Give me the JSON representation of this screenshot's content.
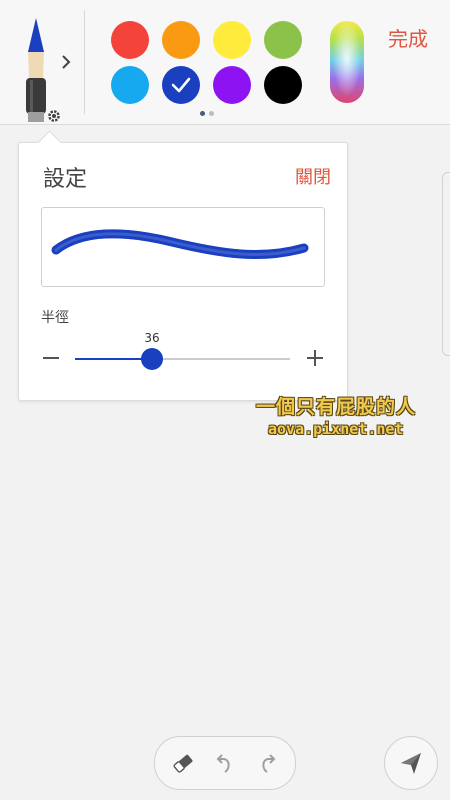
{
  "toolbar": {
    "done_label": "完成",
    "palette": [
      {
        "name": "red",
        "hex": "#f4433a",
        "selected": false
      },
      {
        "name": "orange",
        "hex": "#fa9a12",
        "selected": false
      },
      {
        "name": "yellow",
        "hex": "#ffeb3b",
        "selected": false
      },
      {
        "name": "green",
        "hex": "#8bc34a",
        "selected": false
      },
      {
        "name": "light-blue",
        "hex": "#16a9f0",
        "selected": false
      },
      {
        "name": "blue",
        "hex": "#1a3fbf",
        "selected": true
      },
      {
        "name": "purple",
        "hex": "#8e13f2",
        "selected": false
      },
      {
        "name": "black",
        "hex": "#000000",
        "selected": false
      }
    ],
    "palette_pages": 2,
    "palette_page_active": 1
  },
  "settings_panel": {
    "title": "設定",
    "close_label": "關閉",
    "radius": {
      "label": "半徑",
      "value": "36",
      "fraction": 0.36
    }
  },
  "watermark": {
    "line1": "一個只有屁股的人",
    "line2": "aova.pixnet.net"
  },
  "colors": {
    "accent": "#e0553d",
    "brush": "#1a3fbf"
  },
  "icons": {
    "brush": "paintbrush-icon",
    "settings": "gear-icon",
    "expand": "chevron-right-icon",
    "eraser": "eraser-icon",
    "undo": "undo-icon",
    "redo": "redo-icon",
    "send": "send-icon"
  }
}
